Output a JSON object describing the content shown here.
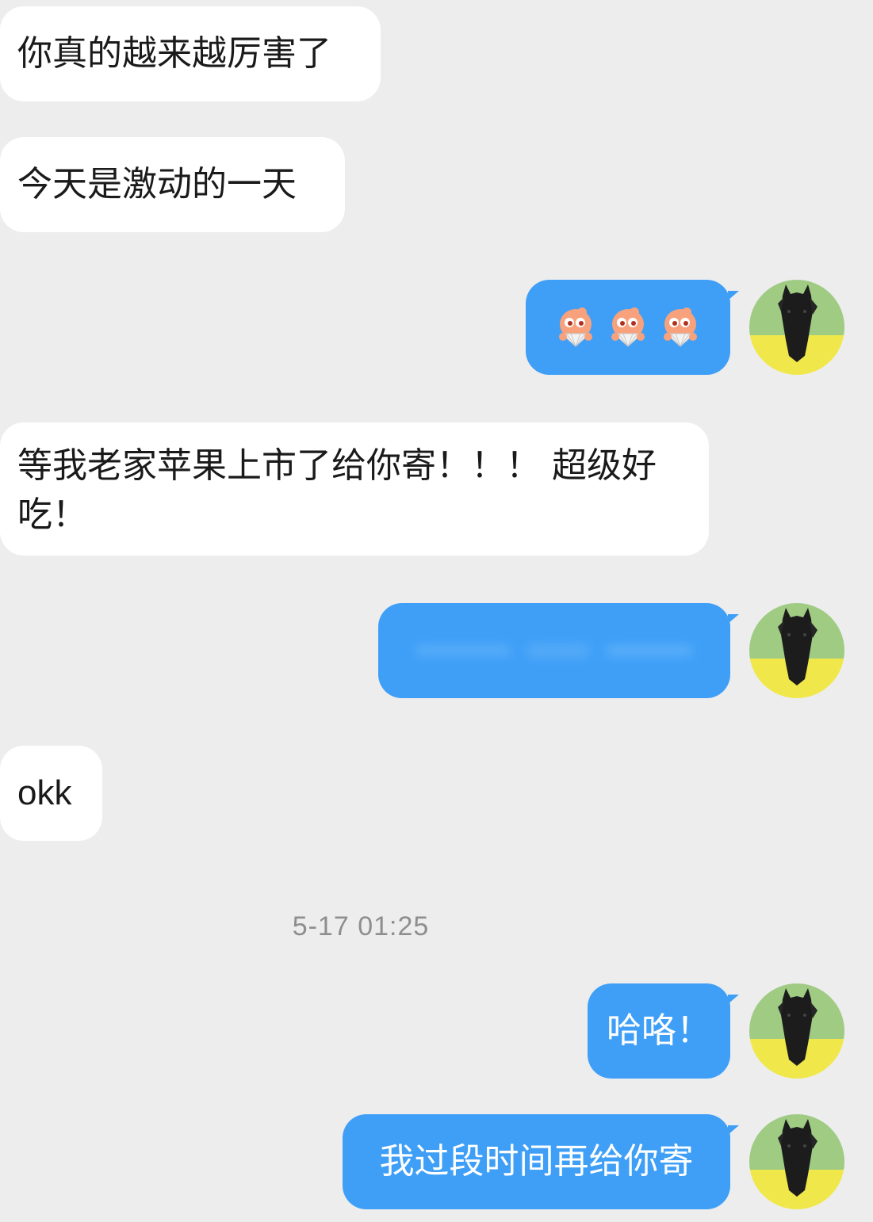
{
  "messages": [
    {
      "side": "incoming",
      "text": "你真的越来越厉害了"
    },
    {
      "side": "incoming",
      "text": "今天是激动的一天"
    },
    {
      "side": "outgoing",
      "type": "emoji",
      "emojis": [
        "fan-face-emoji",
        "fan-face-emoji",
        "fan-face-emoji"
      ]
    },
    {
      "side": "incoming",
      "text": "等我老家苹果上市了给你寄！！！ 超级好吃！"
    },
    {
      "side": "outgoing",
      "type": "blurred"
    },
    {
      "side": "incoming",
      "text": "okk"
    },
    {
      "side": "outgoing",
      "text": "哈咯！"
    },
    {
      "side": "outgoing",
      "text": "我过段时间再给你寄"
    }
  ],
  "timestamp": "5-17 01:25",
  "colors": {
    "background": "#ededed",
    "incoming_bubble": "#ffffff",
    "outgoing_bubble": "#3f9ff7",
    "timestamp_text": "#8e8e8e"
  },
  "avatar": {
    "icon": "horse-avatar-icon"
  }
}
